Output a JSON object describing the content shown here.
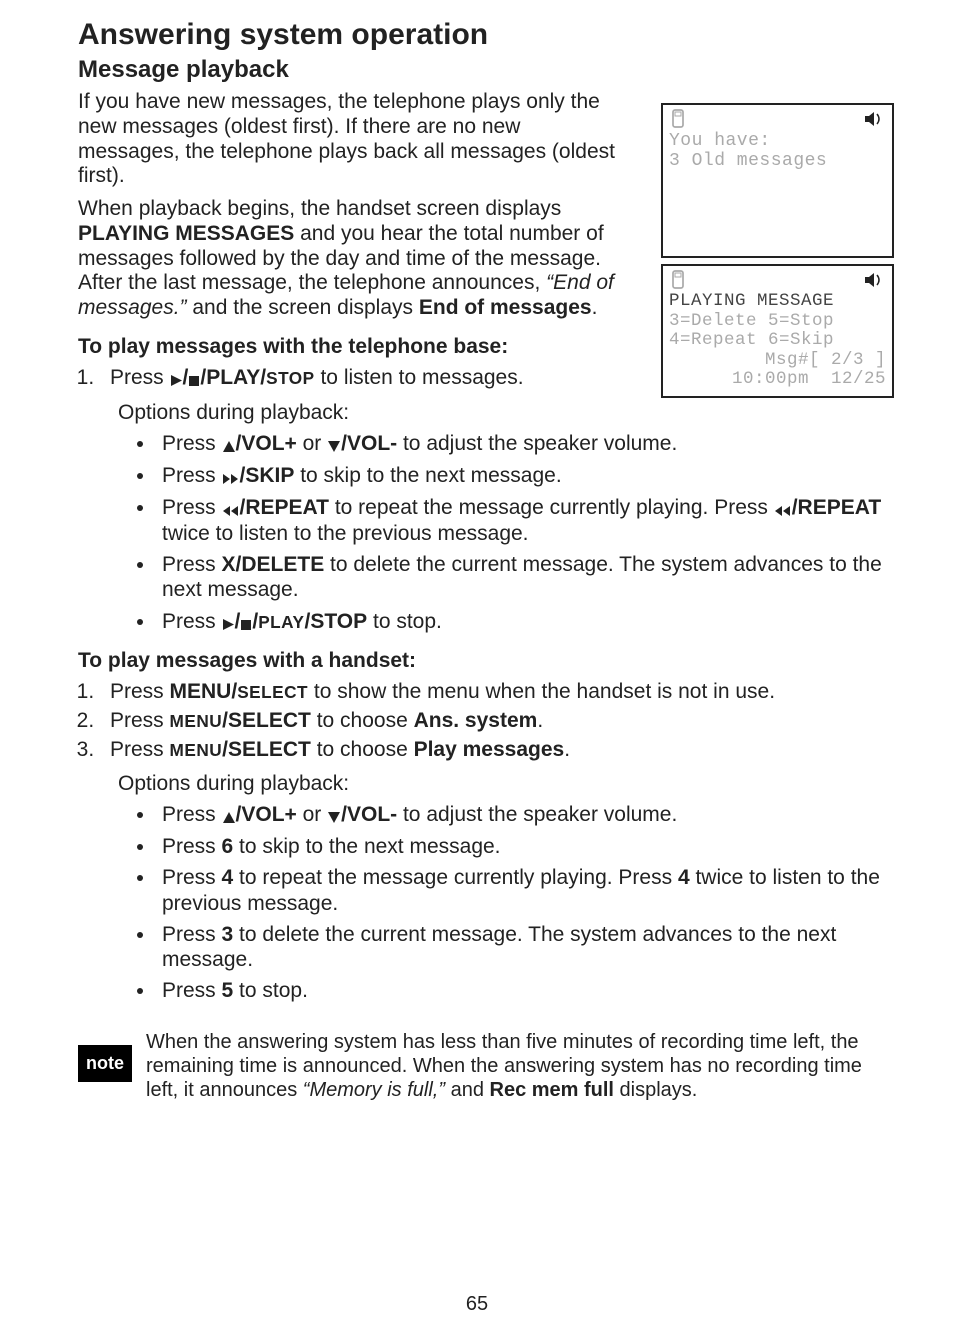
{
  "title": "Answering system operation",
  "subtitle": "Message playback",
  "para1_a": "If you have new messages, the telephone plays only the new messages (oldest first). If there are no new messages, the telephone plays back all messages (oldest first).",
  "para2_a": "When playback begins, the handset screen displays ",
  "para2_b": "PLAYING MESSAGES",
  "para2_c": " and you hear the total number of messages followed by the day and time of the message. After the last message, the telephone announces, ",
  "para2_d": "“End of messages.”",
  "para2_e": " and the screen displays ",
  "para2_f": "End of messages",
  "para2_g": ".",
  "sectionA": "To play messages with the telephone base:",
  "a1_a": "Press ",
  "a1_b": "/PLAY/",
  "a1_c": "STOP",
  "a1_d": " to listen to messages.",
  "optlabel": "Options during playback:",
  "ab1_a": "Press  ",
  "ab1_b": "/VOL+",
  "ab1_c": " or ",
  "ab1_d": "/VOL-",
  "ab1_e": " to adjust the speaker volume.",
  "ab2_a": "Press ",
  "ab2_b": "/SKIP",
  "ab2_c": " to skip to the next message.",
  "ab3_a": "Press ",
  "ab3_b": "/REPEAT",
  "ab3_c": " to repeat the message currently playing. Press ",
  "ab3_d": "/REPEAT",
  "ab3_e": " twice to listen to the previous message.",
  "ab4_a": "Press ",
  "ab4_b": "X/DELETE",
  "ab4_c": " to delete the current message. The system advances to the next message.",
  "ab5_a": "Press ",
  "ab5_b": "/",
  "ab5_c": "PLAY",
  "ab5_d": "/STOP",
  "ab5_e": " to stop.",
  "sectionB": "To play messages with a handset:",
  "b1_a": "Press ",
  "b1_b": "MENU/",
  "b1_c": "SELECT",
  "b1_d": " to show the menu when the handset is not in use.",
  "b2_a": "Press ",
  "b2_b": "MENU",
  "b2_c": "/SELECT",
  "b2_d": " to choose ",
  "b2_e": "Ans. system",
  "b2_f": ".",
  "b3_a": "Press ",
  "b3_b": "MENU",
  "b3_c": "/SELECT",
  "b3_d": " to choose ",
  "b3_e": "Play messages",
  "b3_f": ".",
  "bb1_a": "Press ",
  "bb1_b": "/VOL+",
  "bb1_c": " or ",
  "bb1_d": "/VOL-",
  "bb1_e": " to adjust the speaker volume.",
  "bb2_a": "Press ",
  "bb2_b": "6",
  "bb2_c": " to skip to the next message.",
  "bb3_a": "Press ",
  "bb3_b": "4",
  "bb3_c": " to repeat the message currently playing. Press ",
  "bb3_d": "4",
  "bb3_e": " twice to listen to the previous message.",
  "bb4_a": "Press ",
  "bb4_b": "3",
  "bb4_c": " to delete the current message. The system advances to the next message.",
  "bb5_a": "Press ",
  "bb5_b": "5",
  "bb5_c": " to stop.",
  "note_badge": "note",
  "note_a": "When the answering system has less than five minutes of recording time left, the remaining time is announced. When the answering system has no recording time left, it announces ",
  "note_b": "“Memory is full,”",
  "note_c": " and ",
  "note_d": "Rec mem full",
  "note_e": " displays.",
  "pagenum": "65",
  "screen1": {
    "l1": "You have:",
    "l2": "3 Old messages"
  },
  "screen2": {
    "l1": "PLAYING MESSAGE",
    "l2": "3=Delete 5=Stop",
    "l3": "4=Repeat 6=Skip",
    "l4": "   Msg#[ 2/3 ]",
    "l5": " 10:00pm  12/25"
  }
}
